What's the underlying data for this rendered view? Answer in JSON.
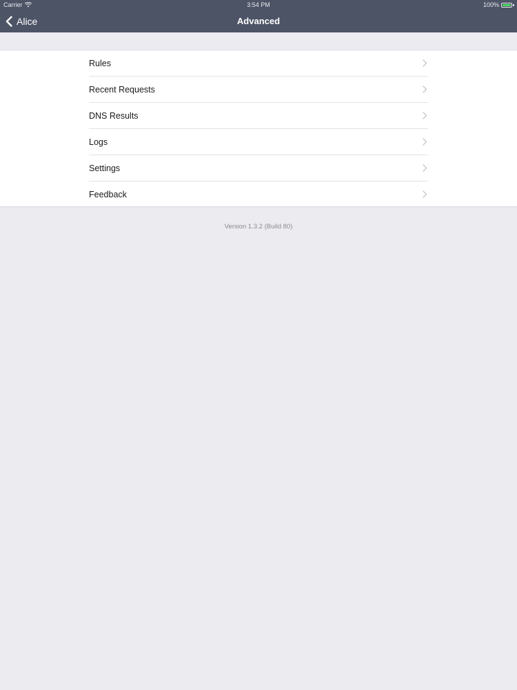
{
  "status_bar": {
    "carrier": "Carrier",
    "wifi_icon": "wifi-icon",
    "time": "3:54 PM",
    "battery_percent": "100%",
    "battery_icon": "battery-icon",
    "battery_color": "#4cd964"
  },
  "navbar": {
    "back_label": "Alice",
    "back_icon": "chevron-left-icon",
    "title": "Advanced",
    "background": "#4d5466"
  },
  "menu": {
    "items": [
      {
        "label": "Rules",
        "icon": "chevron-right-icon"
      },
      {
        "label": "Recent Requests",
        "icon": "chevron-right-icon"
      },
      {
        "label": "DNS Results",
        "icon": "chevron-right-icon"
      },
      {
        "label": "Logs",
        "icon": "chevron-right-icon"
      },
      {
        "label": "Settings",
        "icon": "chevron-right-icon"
      },
      {
        "label": "Feedback",
        "icon": "chevron-right-icon"
      }
    ]
  },
  "footer": {
    "version": "Version 1.3.2 (Build 80)"
  },
  "colors": {
    "page_background": "#ebebf0",
    "cell_background": "#ffffff"
  }
}
